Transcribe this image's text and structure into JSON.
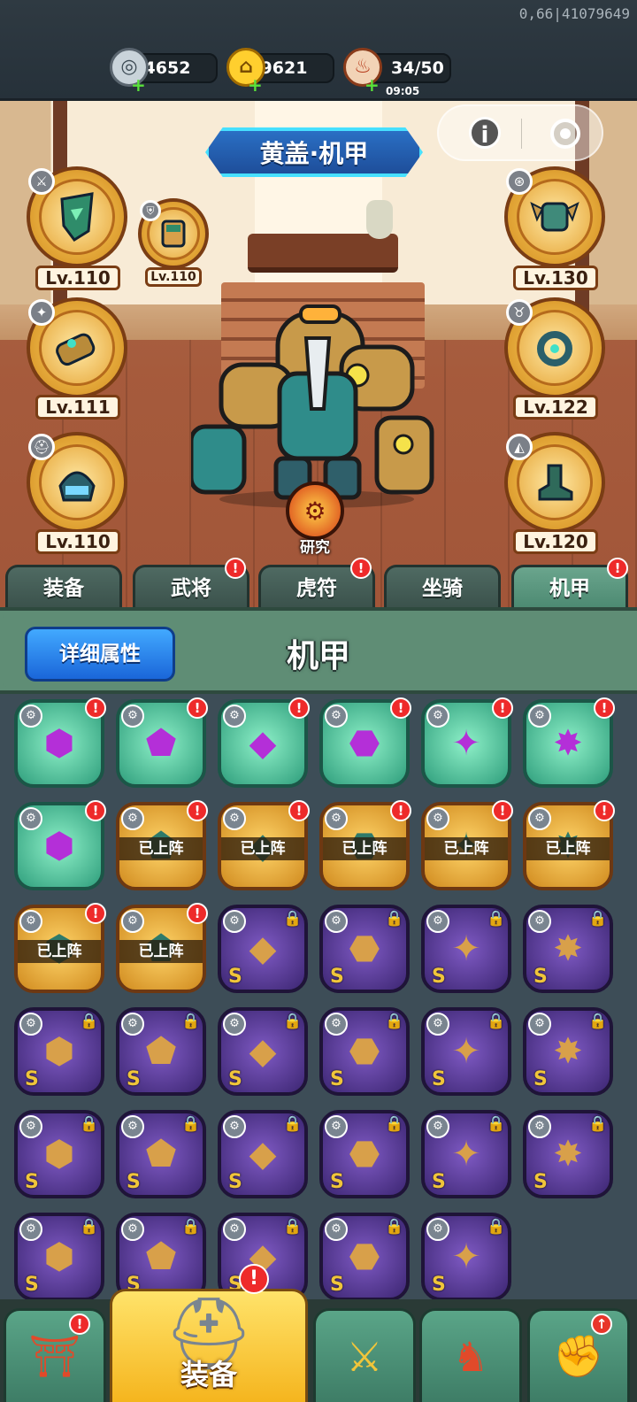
{
  "debug_id": "0,66|41079649",
  "resources": [
    {
      "name": "silver-coin",
      "value": "4652",
      "plus": "+",
      "icon": "coin-icon"
    },
    {
      "name": "gold-ingot",
      "value": "9621",
      "plus": "+",
      "icon": "ingot-icon"
    },
    {
      "name": "stamina",
      "value": "34/50",
      "timer": "09:05",
      "plus": "+",
      "icon": "meat-icon"
    }
  ],
  "scene": {
    "title": "黄盖·机甲",
    "info_label": "i",
    "research_label": "研究"
  },
  "slots": [
    {
      "level": "Lv.110",
      "part": "sword"
    },
    {
      "level": "Lv.110",
      "part": "shield"
    },
    {
      "level": "Lv.111",
      "part": "arm"
    },
    {
      "level": "Lv.110",
      "part": "helmet"
    },
    {
      "level": "Lv.130",
      "part": "armor"
    },
    {
      "level": "Lv.122",
      "part": "amulet"
    },
    {
      "level": "Lv.120",
      "part": "boots"
    }
  ],
  "tabs": [
    {
      "label": "装备",
      "alert": false
    },
    {
      "label": "武将",
      "alert": true
    },
    {
      "label": "虎符",
      "alert": true
    },
    {
      "label": "坐骑",
      "alert": false
    },
    {
      "label": "机甲",
      "alert": true,
      "active": true
    }
  ],
  "alert_mark": "!",
  "panel": {
    "detail_button": "详细属性",
    "title": "机甲"
  },
  "deployed_label": "已上阵",
  "grade_label": "S",
  "inventory": [
    {
      "rarity": "green",
      "alert": true
    },
    {
      "rarity": "green",
      "alert": true
    },
    {
      "rarity": "green",
      "alert": true
    },
    {
      "rarity": "green",
      "alert": true
    },
    {
      "rarity": "green",
      "alert": true
    },
    {
      "rarity": "green",
      "alert": true
    },
    {
      "rarity": "green",
      "alert": true
    },
    {
      "rarity": "gold",
      "alert": true,
      "deployed": true
    },
    {
      "rarity": "gold",
      "alert": true,
      "deployed": true
    },
    {
      "rarity": "gold",
      "alert": true,
      "deployed": true
    },
    {
      "rarity": "gold",
      "alert": true,
      "deployed": true
    },
    {
      "rarity": "gold",
      "alert": true,
      "deployed": true
    },
    {
      "rarity": "gold",
      "alert": true,
      "deployed": true
    },
    {
      "rarity": "gold",
      "alert": true,
      "deployed": true
    },
    {
      "rarity": "purple",
      "locked": true
    },
    {
      "rarity": "purple",
      "locked": true
    },
    {
      "rarity": "purple",
      "locked": true
    },
    {
      "rarity": "purple",
      "locked": true
    },
    {
      "rarity": "purple",
      "locked": true
    },
    {
      "rarity": "purple",
      "locked": true
    },
    {
      "rarity": "purple",
      "locked": true
    },
    {
      "rarity": "purple",
      "locked": true
    },
    {
      "rarity": "purple",
      "locked": true
    },
    {
      "rarity": "purple",
      "locked": true
    },
    {
      "rarity": "purple",
      "locked": true
    },
    {
      "rarity": "purple",
      "locked": true
    },
    {
      "rarity": "purple",
      "locked": true
    },
    {
      "rarity": "purple",
      "locked": true
    },
    {
      "rarity": "purple",
      "locked": true
    },
    {
      "rarity": "purple",
      "locked": true
    },
    {
      "rarity": "purple",
      "locked": true
    },
    {
      "rarity": "purple",
      "locked": true
    },
    {
      "rarity": "purple",
      "locked": true
    },
    {
      "rarity": "purple",
      "locked": true
    },
    {
      "rarity": "purple",
      "locked": true
    }
  ],
  "bottom_nav": [
    {
      "label": "",
      "icon": "castle-icon",
      "alert": true
    },
    {
      "label": "装备",
      "icon": "helmet-icon",
      "alert": true,
      "active": true
    },
    {
      "label": "",
      "icon": "battle-icon",
      "alert": false
    },
    {
      "label": "",
      "icon": "rooster-icon",
      "alert": false
    },
    {
      "label": "",
      "icon": "fist-upgrade-icon",
      "alert": false,
      "upgrade": true
    }
  ]
}
